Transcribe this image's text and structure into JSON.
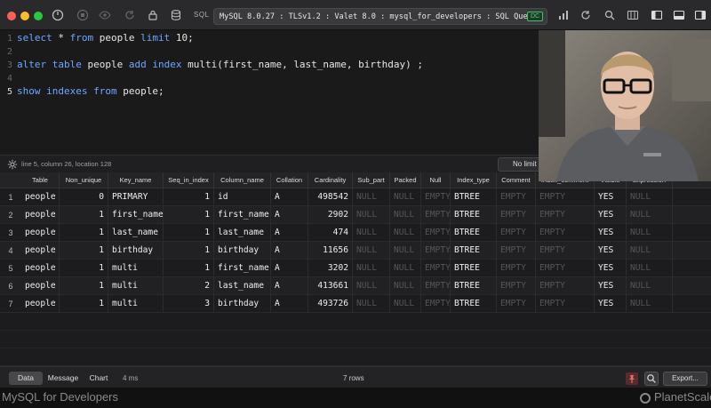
{
  "titlebar": {
    "sql_label": "SQL",
    "connection": "MySQL 8.0.27 : TLSv1.2 : Valet 8.0 : mysql_for_developers : SQL Query",
    "badge": "DC"
  },
  "editor": {
    "lines": [
      {
        "n": "1",
        "active": false,
        "tokens": [
          [
            "kw",
            "select"
          ],
          [
            "tx",
            " * "
          ],
          [
            "kw",
            "from"
          ],
          [
            "tx",
            " people "
          ],
          [
            "kw",
            "limit"
          ],
          [
            "tx",
            " 10;"
          ]
        ]
      },
      {
        "n": "2",
        "active": false,
        "tokens": []
      },
      {
        "n": "3",
        "active": false,
        "tokens": [
          [
            "kw",
            "alter"
          ],
          [
            "tx",
            " "
          ],
          [
            "kw",
            "table"
          ],
          [
            "tx",
            " people "
          ],
          [
            "kw",
            "add"
          ],
          [
            "tx",
            " "
          ],
          [
            "kw",
            "index"
          ],
          [
            "tx",
            " multi(first_name, last_name, birthday) ;"
          ]
        ]
      },
      {
        "n": "4",
        "active": false,
        "tokens": []
      },
      {
        "n": "5",
        "active": true,
        "tokens": [
          [
            "kw",
            "show"
          ],
          [
            "tx",
            " "
          ],
          [
            "kw",
            "indexes"
          ],
          [
            "tx",
            " "
          ],
          [
            "kw",
            "from"
          ],
          [
            "tx",
            " people;"
          ]
        ]
      }
    ]
  },
  "status": {
    "cursor": "line 5, column 26, location 128",
    "limit_button": "No limit"
  },
  "results": {
    "columns": [
      "Table",
      "Non_unique",
      "Key_name",
      "Seq_in_index",
      "Column_name",
      "Collation",
      "Cardinality",
      "Sub_part",
      "Packed",
      "Null",
      "Index_type",
      "Comment",
      "Index_comment",
      "Visible",
      "Expression"
    ],
    "rows": [
      [
        "1",
        "people",
        "0",
        "PRIMARY",
        "1",
        "id",
        "A",
        "498542",
        "NULL",
        "NULL",
        "EMPTY",
        "BTREE",
        "EMPTY",
        "EMPTY",
        "YES",
        "NULL"
      ],
      [
        "2",
        "people",
        "1",
        "first_name",
        "1",
        "first_name",
        "A",
        "2902",
        "NULL",
        "NULL",
        "EMPTY",
        "BTREE",
        "EMPTY",
        "EMPTY",
        "YES",
        "NULL"
      ],
      [
        "3",
        "people",
        "1",
        "last_name",
        "1",
        "last_name",
        "A",
        "474",
        "NULL",
        "NULL",
        "EMPTY",
        "BTREE",
        "EMPTY",
        "EMPTY",
        "YES",
        "NULL"
      ],
      [
        "4",
        "people",
        "1",
        "birthday",
        "1",
        "birthday",
        "A",
        "11656",
        "NULL",
        "NULL",
        "EMPTY",
        "BTREE",
        "EMPTY",
        "EMPTY",
        "YES",
        "NULL"
      ],
      [
        "5",
        "people",
        "1",
        "multi",
        "1",
        "first_name",
        "A",
        "3202",
        "NULL",
        "NULL",
        "EMPTY",
        "BTREE",
        "EMPTY",
        "EMPTY",
        "YES",
        "NULL"
      ],
      [
        "6",
        "people",
        "1",
        "multi",
        "2",
        "last_name",
        "A",
        "413661",
        "NULL",
        "NULL",
        "EMPTY",
        "BTREE",
        "EMPTY",
        "EMPTY",
        "YES",
        "NULL"
      ],
      [
        "7",
        "people",
        "1",
        "multi",
        "3",
        "birthday",
        "A",
        "493726",
        "NULL",
        "NULL",
        "EMPTY",
        "BTREE",
        "EMPTY",
        "EMPTY",
        "YES",
        "NULL"
      ]
    ]
  },
  "bottombar": {
    "tabs": [
      "Data",
      "Message",
      "Chart"
    ],
    "active_tab": "Data",
    "duration": "4 ms",
    "row_count": "7 rows",
    "export_label": "Export..."
  },
  "footer": {
    "left": "MySQL for Developers",
    "right": "PlanetScale"
  },
  "colors": {
    "keyword": "#6ea6ff",
    "accent_green": "#28c840"
  }
}
